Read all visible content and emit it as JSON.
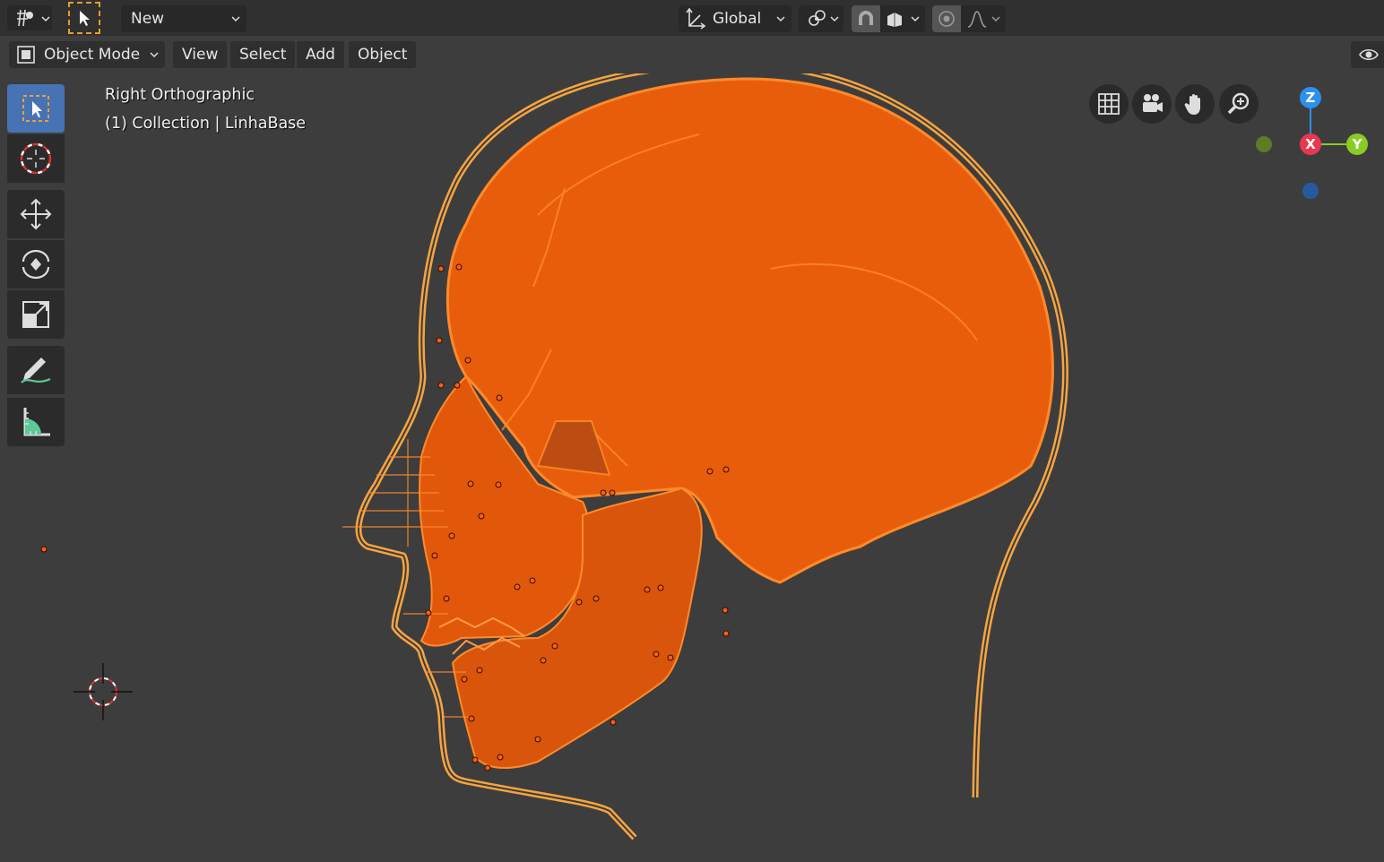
{
  "header": {
    "editor_type_icon": "view3d-icon",
    "select_box_icon": "select-box-icon",
    "new_label": "New",
    "transform_orientation": "Global",
    "pivot_icon": "pivot-icon",
    "snap_icon": "snap-magnet-icon",
    "proportional_icon": "proportional-edit-icon"
  },
  "menubar": {
    "mode_label": "Object Mode",
    "view": "View",
    "select": "Select",
    "add": "Add",
    "object": "Object"
  },
  "viewport": {
    "view_name": "Right Orthographic",
    "collection_info": "(1) Collection | LinhaBase"
  },
  "gizmo": {
    "z_label": "Z",
    "x_label": "X",
    "y_label": "Y",
    "colors": {
      "x": "#e8384f",
      "y": "#8bcb25",
      "z": "#2d8fef",
      "neg_y": "#5b7d24",
      "neg_z": "#275a9c"
    }
  },
  "colors": {
    "selected_mesh": "#e85d0c",
    "outline": "#ff9f3b",
    "active_tool": "#4772b3",
    "background": "#3d3d3d"
  },
  "tools": [
    {
      "name": "select-box-icon"
    },
    {
      "name": "cursor-icon"
    },
    {
      "name": "move-icon"
    },
    {
      "name": "rotate-icon"
    },
    {
      "name": "scale-icon"
    },
    {
      "name": "annotate-icon"
    },
    {
      "name": "measure-icon"
    }
  ]
}
